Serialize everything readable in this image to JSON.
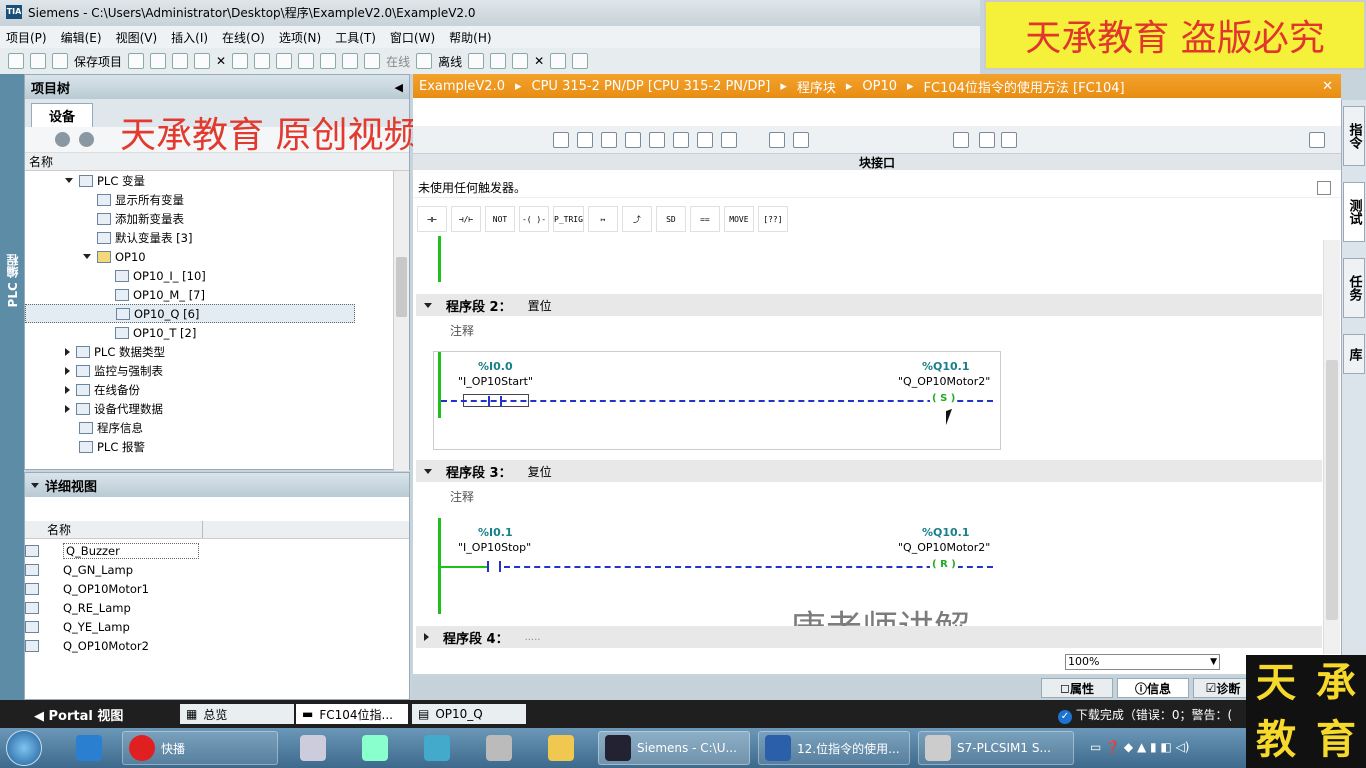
{
  "window": {
    "title": "Siemens  -  C:\\Users\\Administrator\\Desktop\\程序\\ExampleV2.0\\ExampleV2.0",
    "logo": "TIA"
  },
  "menu": [
    "项目(P)",
    "编辑(E)",
    "视图(V)",
    "插入(I)",
    "在线(O)",
    "选项(N)",
    "工具(T)",
    "窗口(W)",
    "帮助(H)"
  ],
  "toolbar": {
    "save_label": "保存项目",
    "online_label": "在线",
    "offline_label": "离线"
  },
  "watermarks": {
    "top_right": "天承教育 盗版必究",
    "overlay": "天承教育 原创视频",
    "lecturer": "唐老师讲解"
  },
  "left_strip": "PLC 编程",
  "project_tree": {
    "title": "项目树",
    "tab": "设备",
    "col_name": "名称",
    "items": [
      {
        "label": "PLC 变量",
        "level": 1,
        "expand": "down"
      },
      {
        "label": "显示所有变量",
        "level": 2,
        "expand": ""
      },
      {
        "label": "添加新变量表",
        "level": 2,
        "expand": ""
      },
      {
        "label": "默认变量表 [3]",
        "level": 2,
        "expand": ""
      },
      {
        "label": "OP10",
        "level": 2,
        "expand": "down"
      },
      {
        "label": "OP10_I_ [10]",
        "level": 3,
        "expand": ""
      },
      {
        "label": "OP10_M_ [7]",
        "level": 3,
        "expand": ""
      },
      {
        "label": "OP10_Q [6]",
        "level": 3,
        "expand": "",
        "selected": true
      },
      {
        "label": "OP10_T [2]",
        "level": 3,
        "expand": ""
      },
      {
        "label": "PLC 数据类型",
        "level": 1,
        "expand": "right"
      },
      {
        "label": "监控与强制表",
        "level": 1,
        "expand": "right"
      },
      {
        "label": "在线备份",
        "level": 1,
        "expand": "right"
      },
      {
        "label": "设备代理数据",
        "level": 1,
        "expand": "right"
      },
      {
        "label": "程序信息",
        "level": 1,
        "expand": ""
      },
      {
        "label": "PLC 报警",
        "level": 1,
        "expand": ""
      }
    ]
  },
  "detail_view": {
    "title": "详细视图",
    "col_name": "名称",
    "items": [
      "Q_Buzzer",
      "Q_GN_Lamp",
      "Q_OP10Motor1",
      "Q_RE_Lamp",
      "Q_YE_Lamp",
      "Q_OP10Motor2"
    ]
  },
  "editor": {
    "breadcrumb": [
      "ExampleV2.0",
      "CPU 315-2 PN/DP [CPU 315-2 PN/DP]",
      "程序块",
      "OP10",
      "FC104位指令的使用方法 [FC104]"
    ],
    "interface_label": "块接口",
    "trigger_text": "未使用任何触发器。",
    "ladder_buttons": [
      "⊣⊢",
      "⊣/⊢",
      "NOT",
      "-( )-",
      "P_TRIG",
      "↦",
      "⤴",
      "SD",
      "==",
      "MOVE",
      "[??]"
    ],
    "networks": [
      {
        "title": "程序段 2：",
        "name": "置位",
        "comment": "注释",
        "contact_addr": "%I0.0",
        "contact_tag": "\"I_OP10Start\"",
        "coil_addr": "%Q10.1",
        "coil_tag": "\"Q_OP10Motor2\"",
        "coil": "S"
      },
      {
        "title": "程序段 3：",
        "name": "复位",
        "comment": "注释",
        "contact_addr": "%I0.1",
        "contact_tag": "\"I_OP10Stop\"",
        "coil_addr": "%Q10.1",
        "coil_tag": "\"Q_OP10Motor2\"",
        "coil": "R"
      },
      {
        "title": "程序段 4：",
        "name": ".....",
        "comment": "",
        "contact_addr": "",
        "contact_tag": "",
        "coil_addr": "",
        "coil_tag": "",
        "coil": ""
      }
    ],
    "zoom": "100%"
  },
  "right_tabs": [
    "指令",
    "测试",
    "任务",
    "库"
  ],
  "bottom_tabs": {
    "properties": "属性",
    "info": "信息",
    "diagnostics": "诊断"
  },
  "status": {
    "portal": "Portal 视图",
    "tab_overview": "总览",
    "tab_fc": "FC104位指...",
    "tab_q": "OP10_Q",
    "download": "下载完成（错误：0；警告：("
  },
  "taskbar": [
    {
      "label": "快播"
    },
    {
      "label": "Siemens  -  C:\\U..."
    },
    {
      "label": "12.位指令的使用..."
    },
    {
      "label": "S7-PLCSIM1   S..."
    }
  ],
  "brand_logo": [
    "天",
    "承",
    "教",
    "育"
  ],
  "colors": {
    "accent": "#e88d14",
    "rail": "#1ec01e",
    "address": "#18808a",
    "dashed": "#2233cc"
  }
}
